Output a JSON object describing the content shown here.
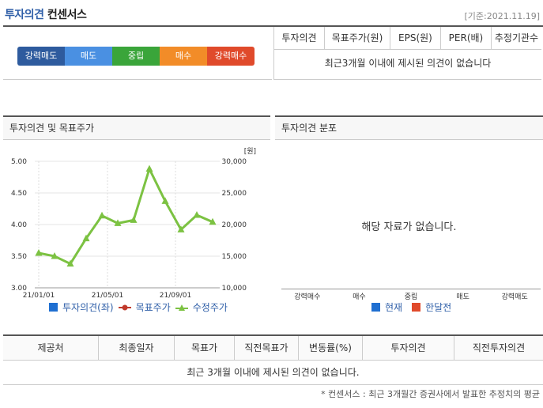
{
  "header": {
    "title_part1": "투자의견",
    "title_part2": "컨센서스",
    "date": "[기준:2021.11.19]"
  },
  "scale": {
    "items": [
      {
        "label": "강력매도",
        "color": "#2e5b9e"
      },
      {
        "label": "매도",
        "color": "#4a90e2"
      },
      {
        "label": "중립",
        "color": "#3aa53a"
      },
      {
        "label": "매수",
        "color": "#f28c28"
      },
      {
        "label": "강력매수",
        "color": "#e04a2b"
      }
    ]
  },
  "consensus_table": {
    "headers": [
      "투자의견",
      "목표주가(원)",
      "EPS(원)",
      "PER(배)",
      "추정기관수"
    ],
    "empty": "최근3개월 이내에 제시된 의견이 없습니다"
  },
  "left_panel": {
    "title": "투자의견 및 목표주가",
    "legend": [
      "투자의견(좌)",
      "목표주가",
      "수정주가"
    ]
  },
  "right_panel": {
    "title": "투자의견 분포",
    "empty": "해당 자료가 없습니다.",
    "categories": [
      "강력매수",
      "매수",
      "중립",
      "매도",
      "강력매도"
    ],
    "legend": [
      "현재",
      "한달전"
    ]
  },
  "bottom_table": {
    "headers": [
      "제공처",
      "최종일자",
      "목표가",
      "직전목표가",
      "변동률(%)",
      "투자의견",
      "직전투자의견"
    ],
    "empty": "최근 3개월 이내에 제시된 의견이 없습니다."
  },
  "footnote": "* 컨센서스 : 최근 3개월간 증권사에서 발표한 추정치의 평균",
  "chart_data": {
    "type": "line",
    "xlabel": "",
    "ylabel": "",
    "x_ticks": [
      "21/01/01",
      "21/05/01",
      "21/09/01"
    ],
    "y_left_ticks": [
      "5.00",
      "4.50",
      "4.00",
      "3.50",
      "3.00"
    ],
    "y_left_range": [
      3.0,
      5.0
    ],
    "y_right_ticks": [
      "30,000",
      "25,000",
      "20,000",
      "15,000",
      "10,000"
    ],
    "y_right_range": [
      10000,
      30000
    ],
    "y_right_unit": "[원]",
    "series": [
      {
        "name": "수정주가",
        "color": "#7cc242",
        "values": [
          15500,
          15000,
          13800,
          17800,
          21400,
          20200,
          20700,
          28800,
          23700,
          19200,
          21500,
          20400
        ]
      }
    ]
  }
}
